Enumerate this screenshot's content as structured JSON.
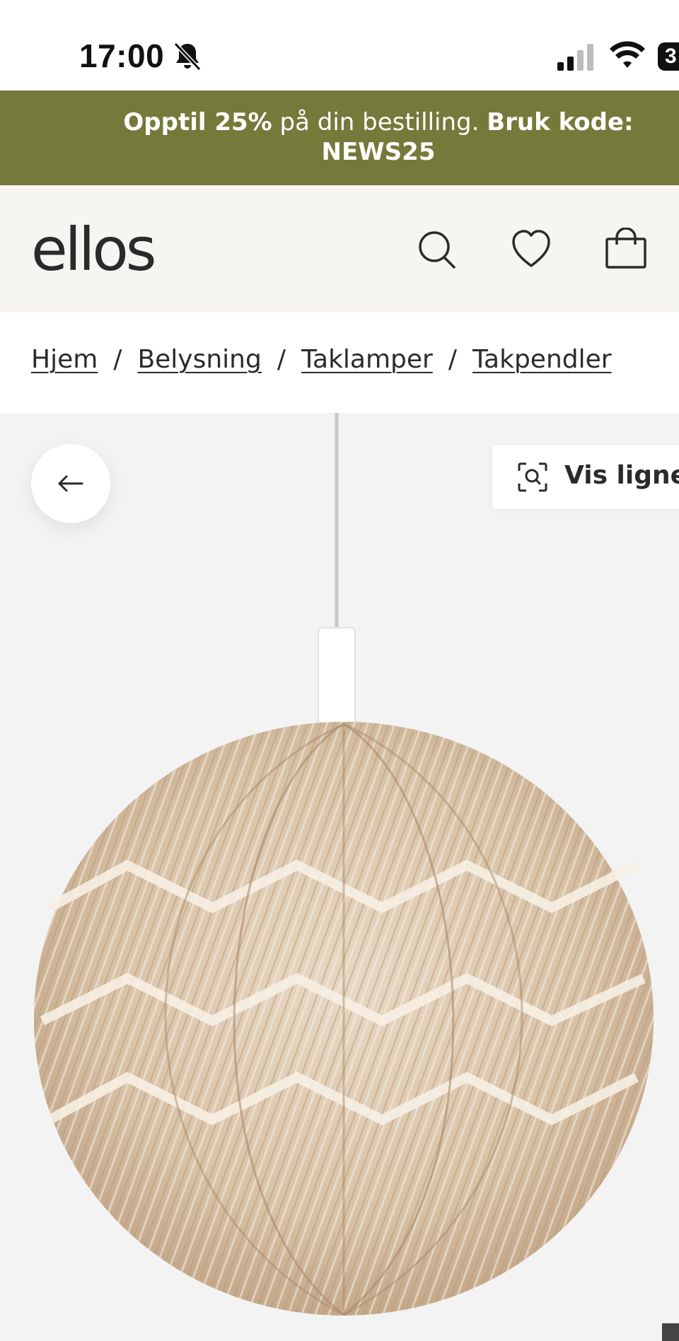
{
  "status_bar": {
    "time": "17:00",
    "battery": "3",
    "icons": [
      "bell-muted-icon",
      "cellular-signal-icon",
      "wifi-icon",
      "battery-icon"
    ]
  },
  "promo": {
    "bold_1": "Opptil 25%",
    "text": " på din bestilling. ",
    "bold_2": "Bruk kode: NEWS25",
    "background": "#75793a"
  },
  "header": {
    "logo": "ellos",
    "icons": [
      "search-icon",
      "heart-icon",
      "bag-icon"
    ],
    "background": "#f6f5f2"
  },
  "breadcrumb": {
    "items": [
      "Hjem",
      "Belysning",
      "Taklamper",
      "Takpendler"
    ],
    "separator": "/"
  },
  "product_image": {
    "back_icon": "arrow-left-icon",
    "visual_search_icon": "visual-search-icon",
    "visual_search_label": "Vis lignende"
  }
}
